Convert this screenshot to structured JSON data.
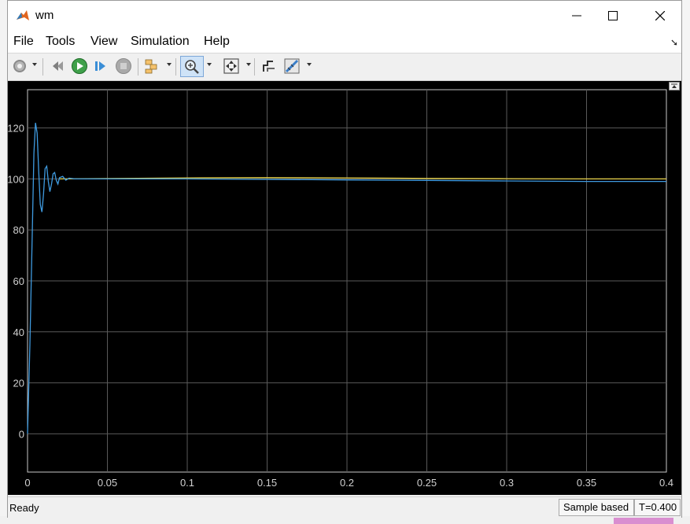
{
  "window": {
    "title": "wm"
  },
  "menu": {
    "file": "File",
    "tools": "Tools",
    "view": "View",
    "simulation": "Simulation",
    "help": "Help"
  },
  "status": {
    "ready": "Ready",
    "mode": "Sample based",
    "time": "T=0.400"
  },
  "colors": {
    "plot_bg": "#000000",
    "grid": "#5a5a5a",
    "axes": "#c8c8c8",
    "series_blue": "#3f9be0",
    "series_yellow": "#e8d24a"
  },
  "icons": [
    "gear-icon",
    "step-back-icon",
    "run-icon",
    "step-forward-icon",
    "stop-icon",
    "signal-selector-icon",
    "zoom-icon",
    "fit-to-view-icon",
    "style-icon",
    "measure-icon"
  ],
  "chart_data": {
    "type": "line",
    "title": "",
    "xlabel": "",
    "ylabel": "",
    "xlim": [
      0,
      0.4
    ],
    "ylim": [
      -15,
      135
    ],
    "grid": true,
    "xticks": [
      0,
      0.05,
      0.1,
      0.15,
      0.2,
      0.25,
      0.3,
      0.35,
      0.4
    ],
    "xtick_labels": [
      "0",
      "0.05",
      "0.1",
      "0.15",
      "0.2",
      "0.25",
      "0.3",
      "0.35",
      "0.4"
    ],
    "yticks": [
      0,
      20,
      40,
      60,
      80,
      100,
      120
    ],
    "ytick_labels": [
      "0",
      "20",
      "40",
      "60",
      "80",
      "100",
      "120"
    ],
    "series": [
      {
        "color": "#3f9be0",
        "points": [
          [
            0,
            0
          ],
          [
            0.0015,
            35
          ],
          [
            0.003,
            80
          ],
          [
            0.004,
            110
          ],
          [
            0.005,
            122
          ],
          [
            0.006,
            118
          ],
          [
            0.007,
            103
          ],
          [
            0.008,
            90
          ],
          [
            0.009,
            87
          ],
          [
            0.01,
            94
          ],
          [
            0.011,
            104
          ],
          [
            0.012,
            105
          ],
          [
            0.013,
            99
          ],
          [
            0.014,
            95
          ],
          [
            0.015,
            98
          ],
          [
            0.016,
            102
          ],
          [
            0.017,
            102.5
          ],
          [
            0.018,
            99.5
          ],
          [
            0.019,
            98
          ],
          [
            0.02,
            100.5
          ],
          [
            0.022,
            101
          ],
          [
            0.024,
            99.5
          ],
          [
            0.026,
            100.3
          ],
          [
            0.03,
            100
          ],
          [
            0.05,
            100
          ],
          [
            0.1,
            100
          ],
          [
            0.15,
            99.8
          ],
          [
            0.2,
            99.6
          ],
          [
            0.25,
            99.4
          ],
          [
            0.3,
            99.2
          ],
          [
            0.35,
            99
          ],
          [
            0.4,
            99
          ]
        ]
      },
      {
        "color": "#e8d24a",
        "points": [
          [
            0.02,
            100
          ],
          [
            0.1,
            100.4
          ],
          [
            0.15,
            100.5
          ],
          [
            0.2,
            100.4
          ],
          [
            0.25,
            100.2
          ],
          [
            0.3,
            100.1
          ],
          [
            0.35,
            100
          ],
          [
            0.4,
            100
          ]
        ]
      }
    ]
  }
}
